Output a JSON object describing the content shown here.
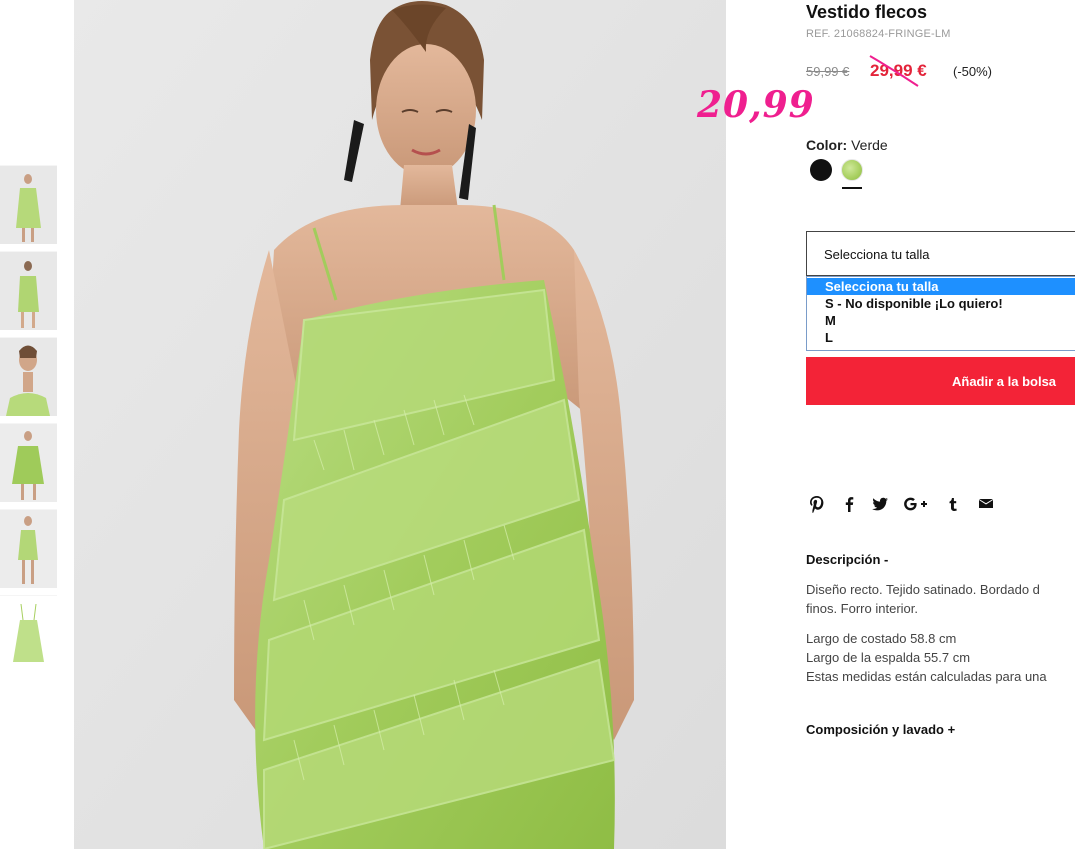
{
  "product": {
    "title": "Vestido flecos",
    "ref": "REF. 21068824-FRINGE-LM",
    "price_old": "59,99 €",
    "price_sale": "29,99 €",
    "discount": "(-50%)",
    "handwritten_price": "20,99"
  },
  "color": {
    "label": "Color:",
    "value": "Verde",
    "swatches": [
      {
        "name": "black",
        "hex": "#111111"
      },
      {
        "name": "green",
        "hex": "#a7cf5f"
      }
    ]
  },
  "size": {
    "select_label": "Selecciona tu talla",
    "options": [
      "Selecciona tu talla",
      "S - No disponible ¡Lo quiero!",
      "M",
      "L"
    ]
  },
  "actions": {
    "add_to_bag": "Añadir a la bolsa"
  },
  "share": [
    "pinterest-icon",
    "facebook-icon",
    "twitter-icon",
    "google-plus-icon",
    "tumblr-icon",
    "email-icon"
  ],
  "description": {
    "title": "Descripción -",
    "lines": [
      "Diseño recto. Tejido satinado. Bordado d",
      "finos. Forro interior.",
      "Largo de costado 58.8 cm",
      "Largo de la espalda 55.7 cm",
      "Estas medidas están calculadas para una"
    ]
  },
  "composition": {
    "title": "Composición y lavado +"
  },
  "colors": {
    "sale_red": "#e3243a",
    "button_red": "#f32337",
    "handwritten_pink": "#ef1f8f",
    "dress_green": "#a7cf5f",
    "selected_option_blue": "#1e90ff"
  }
}
